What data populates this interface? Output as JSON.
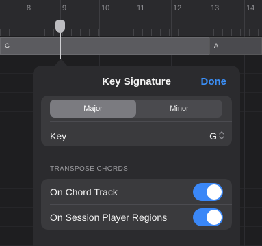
{
  "ruler": {
    "bars": [
      {
        "num": "8",
        "pos": 36
      },
      {
        "num": "9",
        "pos": 88
      },
      {
        "num": "10",
        "pos": 145
      },
      {
        "num": "11",
        "pos": 197
      },
      {
        "num": "12",
        "pos": 250
      },
      {
        "num": "13",
        "pos": 305
      },
      {
        "num": "14",
        "pos": 357
      }
    ]
  },
  "track": {
    "regions": [
      {
        "label": "G"
      },
      {
        "label": "A"
      }
    ]
  },
  "popover": {
    "title": "Key Signature",
    "done_label": "Done",
    "segmented": {
      "options": [
        "Major",
        "Minor"
      ],
      "selected": "Major"
    },
    "key": {
      "label": "Key",
      "value": "G"
    },
    "transpose_header": "TRANSPOSE CHORDS",
    "toggles": [
      {
        "label": "On Chord Track",
        "on": true
      },
      {
        "label": "On Session Player Regions",
        "on": true
      }
    ]
  },
  "colors": {
    "accent": "#3b8ff7",
    "toggle_on": "#3a87f7",
    "popover_bg": "#2b2b2e",
    "group_bg": "#3a3a3d"
  }
}
